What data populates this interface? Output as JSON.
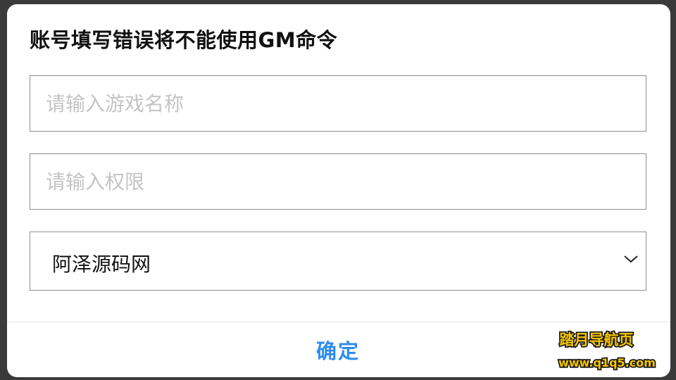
{
  "dialog": {
    "title": "账号填写错误将不能使用GM命令"
  },
  "form": {
    "game_name": {
      "value": "",
      "placeholder": "请输入游戏名称"
    },
    "permission": {
      "value": "",
      "placeholder": "请输入权限"
    },
    "server_select": {
      "selected": "阿泽源码网",
      "icon": "chevron-down-icon"
    }
  },
  "actions": {
    "confirm_label": "确定"
  },
  "watermark": {
    "line1": "踏月导航页",
    "line2": "www.q1q5.com"
  },
  "colors": {
    "accent": "#2d8cf0",
    "border": "#8f8f8f",
    "placeholder": "#c4c4c4",
    "watermark_fill": "#f5c400"
  }
}
